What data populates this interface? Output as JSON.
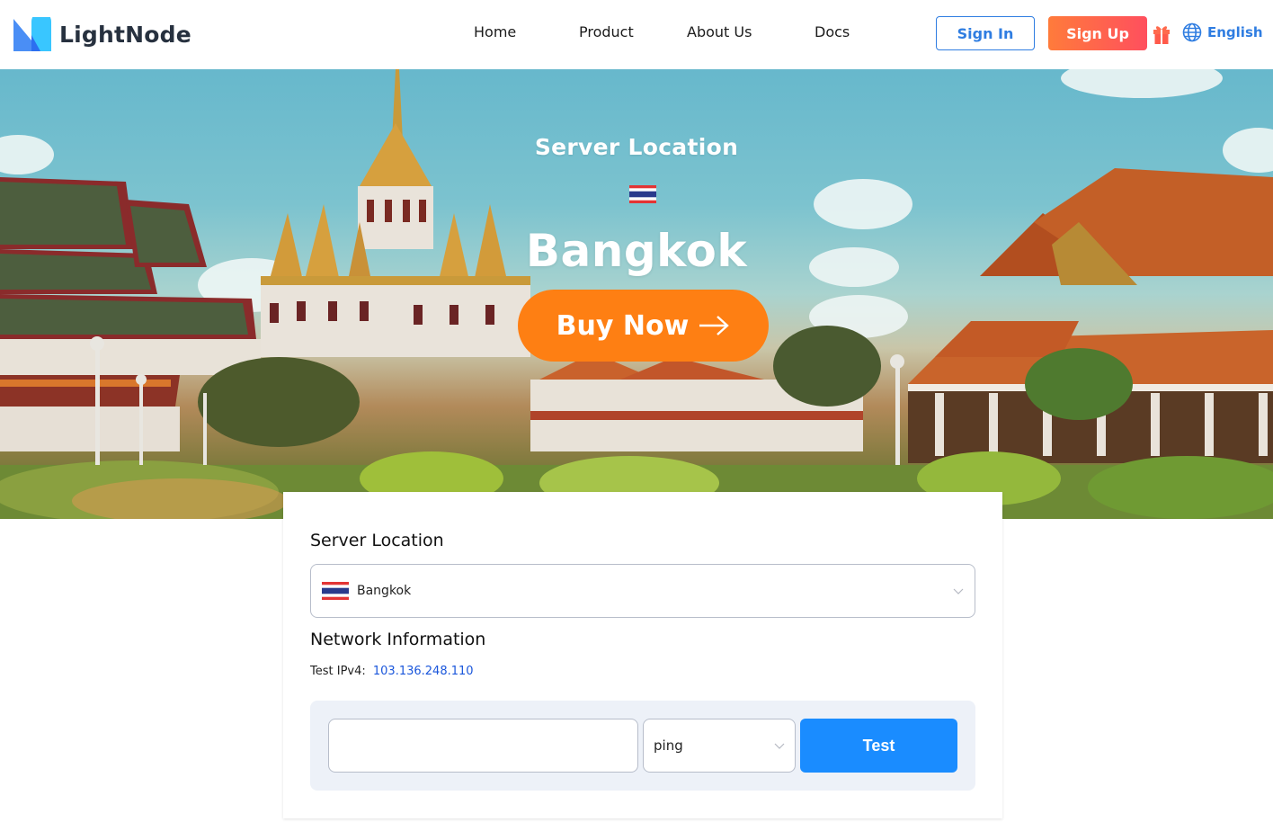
{
  "header": {
    "brand": "LightNode",
    "nav": [
      {
        "label": "Home"
      },
      {
        "label": "Product"
      },
      {
        "label": "About Us"
      },
      {
        "label": "Docs"
      }
    ],
    "sign_in": "Sign In",
    "sign_up": "Sign Up",
    "gift_icon": "gift-icon",
    "language": "English",
    "language_icon": "globe-icon"
  },
  "hero": {
    "subtitle": "Server Location",
    "flag_icon": "thailand-flag-icon",
    "city": "Bangkok",
    "cta": "Buy Now",
    "cta_icon": "arrow-right-icon"
  },
  "panel": {
    "location_heading": "Server Location",
    "location_select": {
      "flag_icon": "thailand-flag-icon",
      "value": "Bangkok"
    },
    "network_heading": "Network Information",
    "ipv4_label": "Test IPv4:",
    "ipv4_value": "103.136.248.110",
    "test": {
      "host_value": "",
      "host_placeholder": "",
      "method_value": "ping",
      "button_label": "Test"
    }
  },
  "colors": {
    "brand_blue": "#2f7de1",
    "signup_gradient_start": "#ff7b3b",
    "signup_gradient_end": "#ff4f5e",
    "cta_orange": "#fe7f13",
    "test_button": "#1a8cff",
    "ip_link": "#1a56db"
  }
}
